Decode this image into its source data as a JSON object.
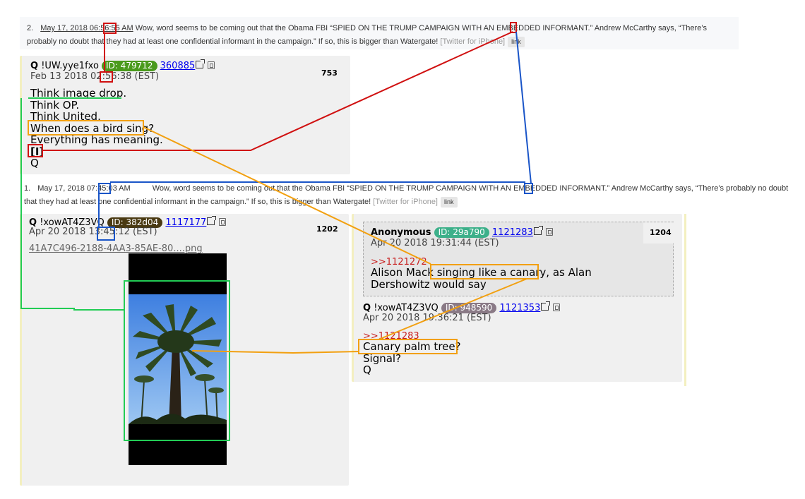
{
  "tweet2": {
    "num": "2.",
    "date": "May 17, 2018 06:56:55 AM",
    "text": "Wow, word seems to be coming out that the Obama FBI “SPIED ON THE TRUMP CAMPAIGN WITH AN EMBEDDED INFORMANT.” Andrew McCarthy says, “There’s probably no doubt that they had at least one confidential informant in the campaign.” If so, this is bigger than Watergate!",
    "source": "[Twitter for iPhone]",
    "link": "link"
  },
  "tweet1": {
    "num": "1.",
    "date": "May 17, 2018 07:45:03 AM",
    "text": "Wow, word seems to be coming out that the Obama FBI “SPIED ON THE TRUMP CAMPAIGN WITH AN EMBEDDED INFORMANT.” Andrew McCarthy says, “There’s probably no doubt that they had at least one confidential informant in the campaign.” If so, this is bigger than Watergate!",
    "source": "[Twitter for iPhone]",
    "link": "link"
  },
  "post753": {
    "name": "Q",
    "trip": "!UW.yye1fxo",
    "id": "ID: 479712",
    "id_color": "#4a9a1c",
    "postlink": "360885",
    "date": "Feb 13 2018 02:56:38 (EST)",
    "num": "753",
    "lines": [
      "Think image drop.",
      "Think OP.",
      "Think United.",
      "When does a bird sing?",
      "Everything has meaning.",
      "[I]",
      "Q"
    ]
  },
  "post1202": {
    "name": "Q",
    "trip": "!xowAT4Z3VQ",
    "id": "ID: 382d04",
    "id_color": "#4a3a12",
    "postlink": "1117177",
    "date": "Apr 20 2018 13:45:12 (EST)",
    "num": "1202",
    "filename": "41A7C496-2188-4AA3-85AE-80....png"
  },
  "post1204": {
    "name": "Anonymous",
    "id": "ID: 29a790",
    "id_color": "#3db08a",
    "postlink": "1121283",
    "date": "Apr 20 2018 19:31:44 (EST)",
    "num": "1204",
    "quote": ">>1121272",
    "text": "Alison Mack singing like a canary, as Alan Dershowitz would say"
  },
  "reply": {
    "name": "Q",
    "trip": "!xowAT4Z3VQ",
    "id": "ID: 948590",
    "id_color": "#8a7a86",
    "postlink": "1121353",
    "date": "Apr 20 2018 19:36:21 (EST)",
    "quote": ">>1121283",
    "lines": [
      "Canary palm tree?",
      "Signal?",
      "Q"
    ]
  },
  "colors": {
    "red": "#d01010",
    "blue": "#1a55c8",
    "green": "#22cc55",
    "orange": "#f2a010"
  }
}
